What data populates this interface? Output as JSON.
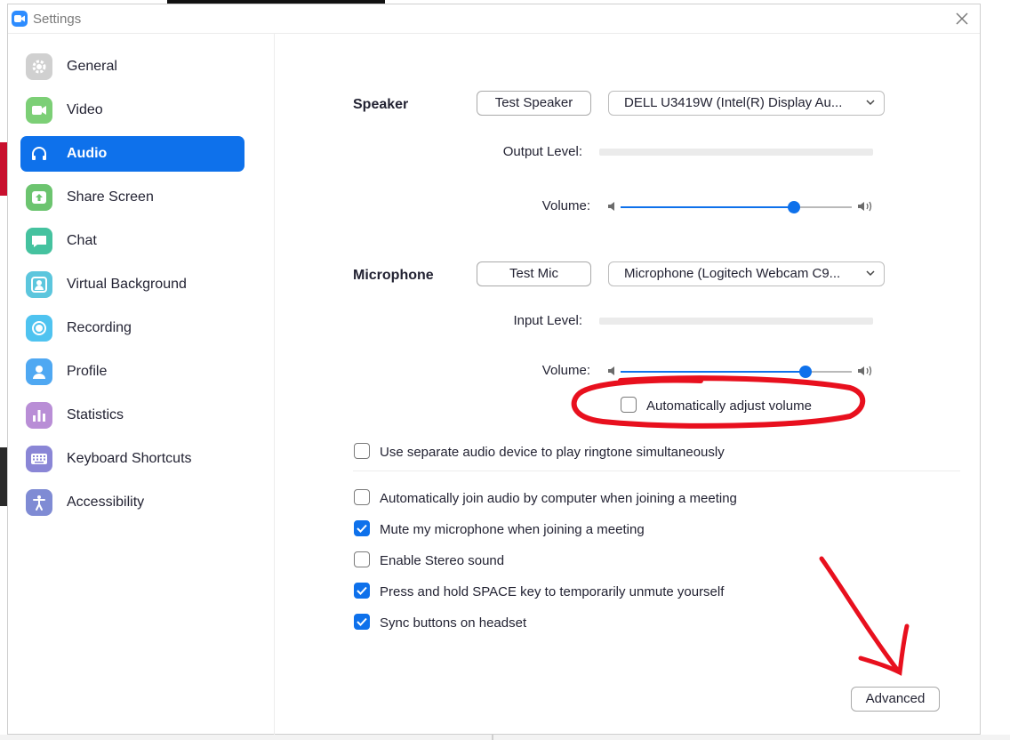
{
  "window": {
    "title": "Settings"
  },
  "sidebar": {
    "items": [
      {
        "label": "General",
        "color": "#c9c9c9"
      },
      {
        "label": "Video",
        "color": "#7ccf76"
      },
      {
        "label": "Audio",
        "color": "#0e71eb",
        "active": true
      },
      {
        "label": "Share Screen",
        "color": "#6cc46f"
      },
      {
        "label": "Chat",
        "color": "#45c29f"
      },
      {
        "label": "Virtual Background",
        "color": "#5cc6dd"
      },
      {
        "label": "Recording",
        "color": "#4fc3f0"
      },
      {
        "label": "Profile",
        "color": "#4fa8f2"
      },
      {
        "label": "Statistics",
        "color": "#b98ed6"
      },
      {
        "label": "Keyboard Shortcuts",
        "color": "#8a86d6"
      },
      {
        "label": "Accessibility",
        "color": "#7f8bd4"
      }
    ]
  },
  "speaker": {
    "label": "Speaker",
    "test_button": "Test Speaker",
    "device": "DELL U3419W (Intel(R) Display Au...",
    "output_level_label": "Output Level:",
    "volume_label": "Volume:",
    "volume": 0.75
  },
  "microphone": {
    "label": "Microphone",
    "test_button": "Test Mic",
    "device": "Microphone (Logitech Webcam C9...",
    "input_level_label": "Input Level:",
    "volume_label": "Volume:",
    "volume": 0.8
  },
  "options": {
    "auto_adjust": {
      "label": "Automatically adjust volume",
      "checked": false
    },
    "separate_ringtone": {
      "label": "Use separate audio device to play ringtone simultaneously",
      "checked": false
    },
    "auto_join": {
      "label": "Automatically join audio by computer when joining a meeting",
      "checked": false
    },
    "mute_on_join": {
      "label": "Mute my microphone when joining a meeting",
      "checked": true
    },
    "stereo": {
      "label": "Enable Stereo sound",
      "checked": false
    },
    "hold_space": {
      "label": "Press and hold SPACE key to temporarily unmute yourself",
      "checked": true
    },
    "sync_headset": {
      "label": "Sync buttons on headset",
      "checked": true
    }
  },
  "advanced_button": "Advanced",
  "colors": {
    "accent": "#0e71eb",
    "annotation": "#e8101e"
  }
}
